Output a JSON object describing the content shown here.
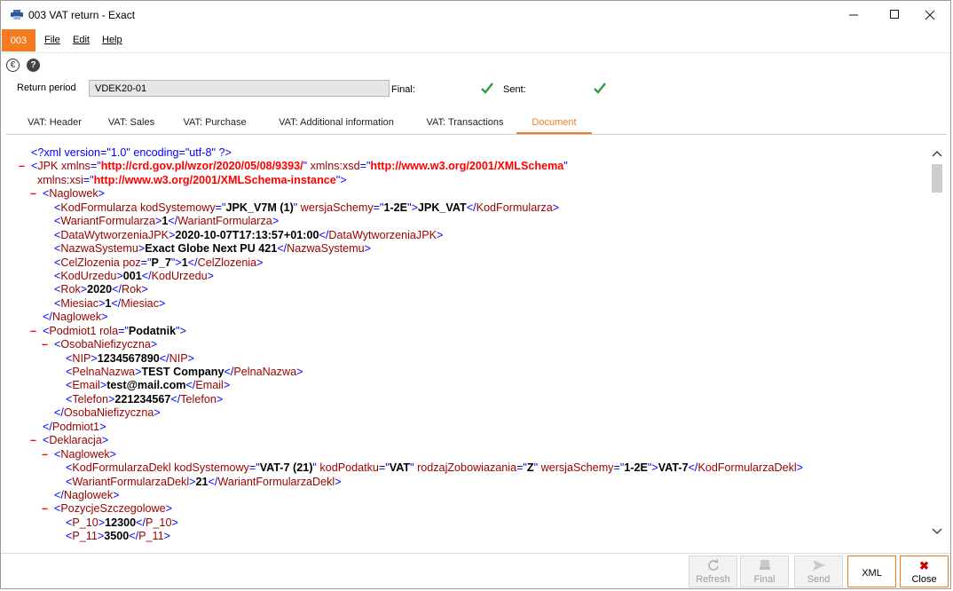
{
  "window": {
    "title": "003 VAT return - Exact"
  },
  "menubar": {
    "company": "003",
    "items": [
      "File",
      "Edit",
      "Help"
    ]
  },
  "form": {
    "return_period_label": "Return period",
    "return_period_value": "VDEK20-01",
    "final_label": "Final:",
    "sent_label": "Sent:",
    "final_checked": true,
    "sent_checked": true
  },
  "tabs": [
    {
      "label": "VAT: Header",
      "active": false
    },
    {
      "label": "VAT: Sales",
      "active": false
    },
    {
      "label": "VAT: Purchase",
      "active": false
    },
    {
      "label": "VAT: Additional information",
      "active": false
    },
    {
      "label": "VAT: Transactions",
      "active": false
    },
    {
      "label": "Document",
      "active": true
    }
  ],
  "xml_lines": [
    {
      "indent": 0,
      "minus": false,
      "html": "<span class=\"pi\">&lt;?xml version=\"1.0\" encoding=\"utf-8\" ?&gt;</span>"
    },
    {
      "indent": 0,
      "minus": true,
      "html": "<span class=\"tg\">&lt;</span><span class=\"tn\">JPK</span> <span class=\"an\">xmlns</span><span class=\"tg\">=\"</span><span class=\"av\">http://crd.gov.pl/wzor/2020/05/08/9393/</span><span class=\"tg\">\"</span> <span class=\"an\">xmlns:xsd</span><span class=\"tg\">=\"</span><span class=\"av\">http://www.w3.org/2001/XMLSchema</span><span class=\"tg\">\"</span>"
    },
    {
      "indent": 0,
      "minus": false,
      "html": "&nbsp;&nbsp;<span class=\"an\">xmlns:xsi</span><span class=\"tg\">=\"</span><span class=\"av\">http://www.w3.org/2001/XMLSchema-instance</span><span class=\"tg\">\"&gt;</span>"
    },
    {
      "indent": 1,
      "minus": true,
      "html": "<span class=\"tg\">&lt;</span><span class=\"tn\">Naglowek</span><span class=\"tg\">&gt;</span>"
    },
    {
      "indent": 2,
      "minus": false,
      "html": "<span class=\"tg\">&lt;</span><span class=\"tn\">KodFormularza</span> <span class=\"an\">kodSystemowy</span><span class=\"tg\">=\"</span><span class=\"av2\">JPK_V7M (1)</span><span class=\"tg\">\"</span> <span class=\"an\">wersjaSchemy</span><span class=\"tg\">=\"</span><span class=\"av2\">1-2E</span><span class=\"tg\">\"&gt;</span><span class=\"tx\">JPK_VAT</span><span class=\"tg\">&lt;/</span><span class=\"tn\">KodFormularza</span><span class=\"tg\">&gt;</span>"
    },
    {
      "indent": 2,
      "minus": false,
      "html": "<span class=\"tg\">&lt;</span><span class=\"tn\">WariantFormularza</span><span class=\"tg\">&gt;</span><span class=\"tx\">1</span><span class=\"tg\">&lt;/</span><span class=\"tn\">WariantFormularza</span><span class=\"tg\">&gt;</span>"
    },
    {
      "indent": 2,
      "minus": false,
      "html": "<span class=\"tg\">&lt;</span><span class=\"tn\">DataWytworzeniaJPK</span><span class=\"tg\">&gt;</span><span class=\"tx\">2020-10-07T17:13:57+01:00</span><span class=\"tg\">&lt;/</span><span class=\"tn\">DataWytworzeniaJPK</span><span class=\"tg\">&gt;</span>"
    },
    {
      "indent": 2,
      "minus": false,
      "html": "<span class=\"tg\">&lt;</span><span class=\"tn\">NazwaSystemu</span><span class=\"tg\">&gt;</span><span class=\"tx\">Exact Globe Next PU 421</span><span class=\"tg\">&lt;/</span><span class=\"tn\">NazwaSystemu</span><span class=\"tg\">&gt;</span>"
    },
    {
      "indent": 2,
      "minus": false,
      "html": "<span class=\"tg\">&lt;</span><span class=\"tn\">CelZlozenia</span> <span class=\"an\">poz</span><span class=\"tg\">=\"</span><span class=\"av2\">P_7</span><span class=\"tg\">\"&gt;</span><span class=\"tx\">1</span><span class=\"tg\">&lt;/</span><span class=\"tn\">CelZlozenia</span><span class=\"tg\">&gt;</span>"
    },
    {
      "indent": 2,
      "minus": false,
      "html": "<span class=\"tg\">&lt;</span><span class=\"tn\">KodUrzedu</span><span class=\"tg\">&gt;</span><span class=\"tx\">001</span><span class=\"tg\">&lt;/</span><span class=\"tn\">KodUrzedu</span><span class=\"tg\">&gt;</span>"
    },
    {
      "indent": 2,
      "minus": false,
      "html": "<span class=\"tg\">&lt;</span><span class=\"tn\">Rok</span><span class=\"tg\">&gt;</span><span class=\"tx\">2020</span><span class=\"tg\">&lt;/</span><span class=\"tn\">Rok</span><span class=\"tg\">&gt;</span>"
    },
    {
      "indent": 2,
      "minus": false,
      "html": "<span class=\"tg\">&lt;</span><span class=\"tn\">Miesiac</span><span class=\"tg\">&gt;</span><span class=\"tx\">1</span><span class=\"tg\">&lt;/</span><span class=\"tn\">Miesiac</span><span class=\"tg\">&gt;</span>"
    },
    {
      "indent": 1,
      "minus": false,
      "html": "<span class=\"tg\">&lt;/</span><span class=\"tn\">Naglowek</span><span class=\"tg\">&gt;</span>"
    },
    {
      "indent": 1,
      "minus": true,
      "html": "<span class=\"tg\">&lt;</span><span class=\"tn\">Podmiot1</span> <span class=\"an\">rola</span><span class=\"tg\">=\"</span><span class=\"av2\">Podatnik</span><span class=\"tg\">\"&gt;</span>"
    },
    {
      "indent": 2,
      "minus": true,
      "html": "<span class=\"tg\">&lt;</span><span class=\"tn\">OsobaNiefizyczna</span><span class=\"tg\">&gt;</span>"
    },
    {
      "indent": 3,
      "minus": false,
      "html": "<span class=\"tg\">&lt;</span><span class=\"tn\">NIP</span><span class=\"tg\">&gt;</span><span class=\"tx\">1234567890</span><span class=\"tg\">&lt;/</span><span class=\"tn\">NIP</span><span class=\"tg\">&gt;</span>"
    },
    {
      "indent": 3,
      "minus": false,
      "html": "<span class=\"tg\">&lt;</span><span class=\"tn\">PelnaNazwa</span><span class=\"tg\">&gt;</span><span class=\"tx\">TEST Company</span><span class=\"tg\">&lt;/</span><span class=\"tn\">PelnaNazwa</span><span class=\"tg\">&gt;</span>"
    },
    {
      "indent": 3,
      "minus": false,
      "html": "<span class=\"tg\">&lt;</span><span class=\"tn\">Email</span><span class=\"tg\">&gt;</span><span class=\"tx\">test@mail.com</span><span class=\"tg\">&lt;/</span><span class=\"tn\">Email</span><span class=\"tg\">&gt;</span>"
    },
    {
      "indent": 3,
      "minus": false,
      "html": "<span class=\"tg\">&lt;</span><span class=\"tn\">Telefon</span><span class=\"tg\">&gt;</span><span class=\"tx\">221234567</span><span class=\"tg\">&lt;/</span><span class=\"tn\">Telefon</span><span class=\"tg\">&gt;</span>"
    },
    {
      "indent": 2,
      "minus": false,
      "html": "<span class=\"tg\">&lt;/</span><span class=\"tn\">OsobaNiefizyczna</span><span class=\"tg\">&gt;</span>"
    },
    {
      "indent": 1,
      "minus": false,
      "html": "<span class=\"tg\">&lt;/</span><span class=\"tn\">Podmiot1</span><span class=\"tg\">&gt;</span>"
    },
    {
      "indent": 1,
      "minus": true,
      "html": "<span class=\"tg\">&lt;</span><span class=\"tn\">Deklaracja</span><span class=\"tg\">&gt;</span>"
    },
    {
      "indent": 2,
      "minus": true,
      "html": "<span class=\"tg\">&lt;</span><span class=\"tn\">Naglowek</span><span class=\"tg\">&gt;</span>"
    },
    {
      "indent": 3,
      "minus": false,
      "html": "<span class=\"tg\">&lt;</span><span class=\"tn\">KodFormularzaDekl</span> <span class=\"an\">kodSystemowy</span><span class=\"tg\">=\"</span><span class=\"av2\">VAT-7 (21)</span><span class=\"tg\">\"</span> <span class=\"an\">kodPodatku</span><span class=\"tg\">=\"</span><span class=\"av2\">VAT</span><span class=\"tg\">\"</span> <span class=\"an\">rodzajZobowiazania</span><span class=\"tg\">=\"</span><span class=\"av2\">Z</span><span class=\"tg\">\"</span> <span class=\"an\">wersjaSchemy</span><span class=\"tg\">=\"</span><span class=\"av2\">1-2E</span><span class=\"tg\">\"&gt;</span><span class=\"tx\">VAT-7</span><span class=\"tg\">&lt;/</span><span class=\"tn\">KodFormularzaDekl</span><span class=\"tg\">&gt;</span>"
    },
    {
      "indent": 3,
      "minus": false,
      "html": "<span class=\"tg\">&lt;</span><span class=\"tn\">WariantFormularzaDekl</span><span class=\"tg\">&gt;</span><span class=\"tx\">21</span><span class=\"tg\">&lt;/</span><span class=\"tn\">WariantFormularzaDekl</span><span class=\"tg\">&gt;</span>"
    },
    {
      "indent": 2,
      "minus": false,
      "html": "<span class=\"tg\">&lt;/</span><span class=\"tn\">Naglowek</span><span class=\"tg\">&gt;</span>"
    },
    {
      "indent": 2,
      "minus": true,
      "html": "<span class=\"tg\">&lt;</span><span class=\"tn\">PozycjeSzczegolowe</span><span class=\"tg\">&gt;</span>"
    },
    {
      "indent": 3,
      "minus": false,
      "html": "<span class=\"tg\">&lt;</span><span class=\"tn\">P_10</span><span class=\"tg\">&gt;</span><span class=\"tx\">12300</span><span class=\"tg\">&lt;/</span><span class=\"tn\">P_10</span><span class=\"tg\">&gt;</span>"
    },
    {
      "indent": 3,
      "minus": false,
      "html": "<span class=\"tg\">&lt;</span><span class=\"tn\">P_11</span><span class=\"tg\">&gt;</span><span class=\"tx\">3500</span><span class=\"tg\">&lt;/</span><span class=\"tn\">P_11</span><span class=\"tg\">&gt;</span>"
    }
  ],
  "footer": {
    "refresh": "Refresh",
    "final": "Final",
    "send": "Send",
    "xml": "XML",
    "close": "Close"
  },
  "colors": {
    "accent": "#f47b20",
    "check": "#2e9e3e",
    "close_x": "#cc0000"
  }
}
